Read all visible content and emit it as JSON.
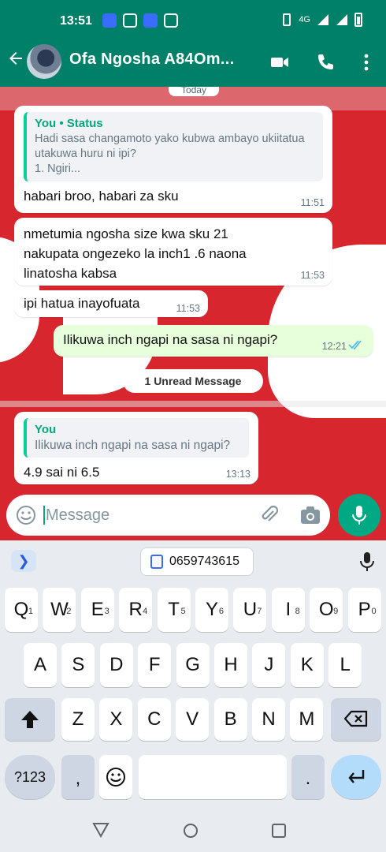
{
  "status_bar": {
    "time": "13:51",
    "network": "4G"
  },
  "header": {
    "contact_name": "Ofa Ngosha A84Om..."
  },
  "chat": {
    "day_label": "Today",
    "messages": [
      {
        "quote_name": "You • Status",
        "quote_text": "Hadi sasa changamoto yako kubwa ambayo ukiitatua utakuwa huru ni ipi?\n1. Ngiri...",
        "text": "habari broo, habari za sku",
        "time": "11:51"
      },
      {
        "text": "nmetumia ngosha size kwa sku 21 nakupata ongezeko la inch1 .6 naona linatosha kabsa",
        "time": "11:53"
      },
      {
        "text": "ipi hatua inayofuata",
        "time": "11:53"
      },
      {
        "text": "Ilikuwa inch ngapi na sasa ni ngapi?",
        "time": "12:21"
      },
      {
        "quote_name": "You",
        "quote_text": "Ilikuwa inch ngapi na sasa ni ngapi?",
        "text": "4.9 sai ni 6.5",
        "time": "13:13"
      }
    ],
    "unread_label": "1 Unread Message"
  },
  "input": {
    "placeholder": "Message"
  },
  "keyboard": {
    "suggestion_chip": "0659743615",
    "row1": [
      {
        "letter": "Q",
        "num": "1"
      },
      {
        "letter": "W",
        "num": "2"
      },
      {
        "letter": "E",
        "num": "3"
      },
      {
        "letter": "R",
        "num": "4"
      },
      {
        "letter": "T",
        "num": "5"
      },
      {
        "letter": "Y",
        "num": "6"
      },
      {
        "letter": "U",
        "num": "7"
      },
      {
        "letter": "I",
        "num": "8"
      },
      {
        "letter": "O",
        "num": "9"
      },
      {
        "letter": "P",
        "num": "0"
      }
    ],
    "row2": [
      "A",
      "S",
      "D",
      "F",
      "G",
      "H",
      "J",
      "K",
      "L"
    ],
    "row3": [
      "Z",
      "X",
      "C",
      "V",
      "B",
      "N",
      "M"
    ],
    "symbols_label": "?123",
    "comma_label": ",",
    "period_label": "."
  },
  "icons": {
    "back": "arrow-left-icon",
    "video": "video-camera-icon",
    "call": "phone-icon",
    "menu": "more-vert-icon",
    "emoji": "emoji-icon",
    "attach": "paperclip-icon",
    "camera": "camera-icon",
    "mic": "mic-icon",
    "read": "double-check-icon",
    "shift": "shift-icon",
    "backspace": "backspace-icon",
    "enter": "enter-icon"
  },
  "colors": {
    "header": "#008069",
    "wallpaper": "#d8262f",
    "accent": "#00a884",
    "outgoing_bubble": "#e7ffdb"
  }
}
